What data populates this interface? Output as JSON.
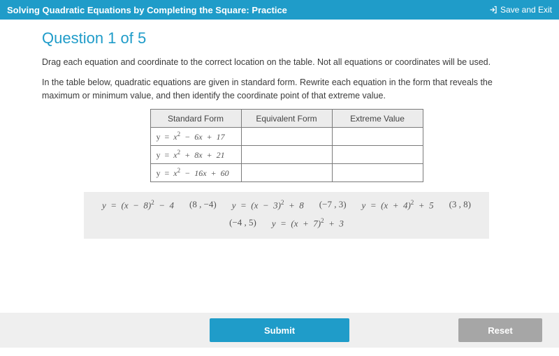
{
  "topbar": {
    "title": "Solving Quadratic Equations by Completing the Square: Practice",
    "save_exit": "Save and Exit"
  },
  "question": {
    "title": "Question 1 of 5",
    "line1": "Drag each equation and coordinate to the correct location on the table. Not all equations or coordinates will be used.",
    "line2": "In the table below, quadratic equations are given in standard form. Rewrite each equation in the form that reveals the maximum or minimum value, and then identify the coordinate point of that extreme value."
  },
  "table": {
    "headers": [
      "Standard Form",
      "Equivalent Form",
      "Extreme Value"
    ],
    "rows": [
      {
        "std": "y  =  x²  −  6x  +  17"
      },
      {
        "std": "y  =  x²  +  8x  +  21"
      },
      {
        "std": "y  =  x²  −  16x  +  60"
      }
    ]
  },
  "tiles": {
    "t1": "y  =  (x  −  8)²  −  4",
    "t2": "(8 , −4)",
    "t3": "y  =  (x  −  3)²  +  8",
    "t4": "(−7 , 3)",
    "t5": "y  =  (x  +  4)²  +  5",
    "t6": "(3 , 8)",
    "t7": "(−4 , 5)",
    "t8": "y  =  (x  +  7)²  +  3"
  },
  "footer": {
    "submit": "Submit",
    "reset": "Reset"
  }
}
